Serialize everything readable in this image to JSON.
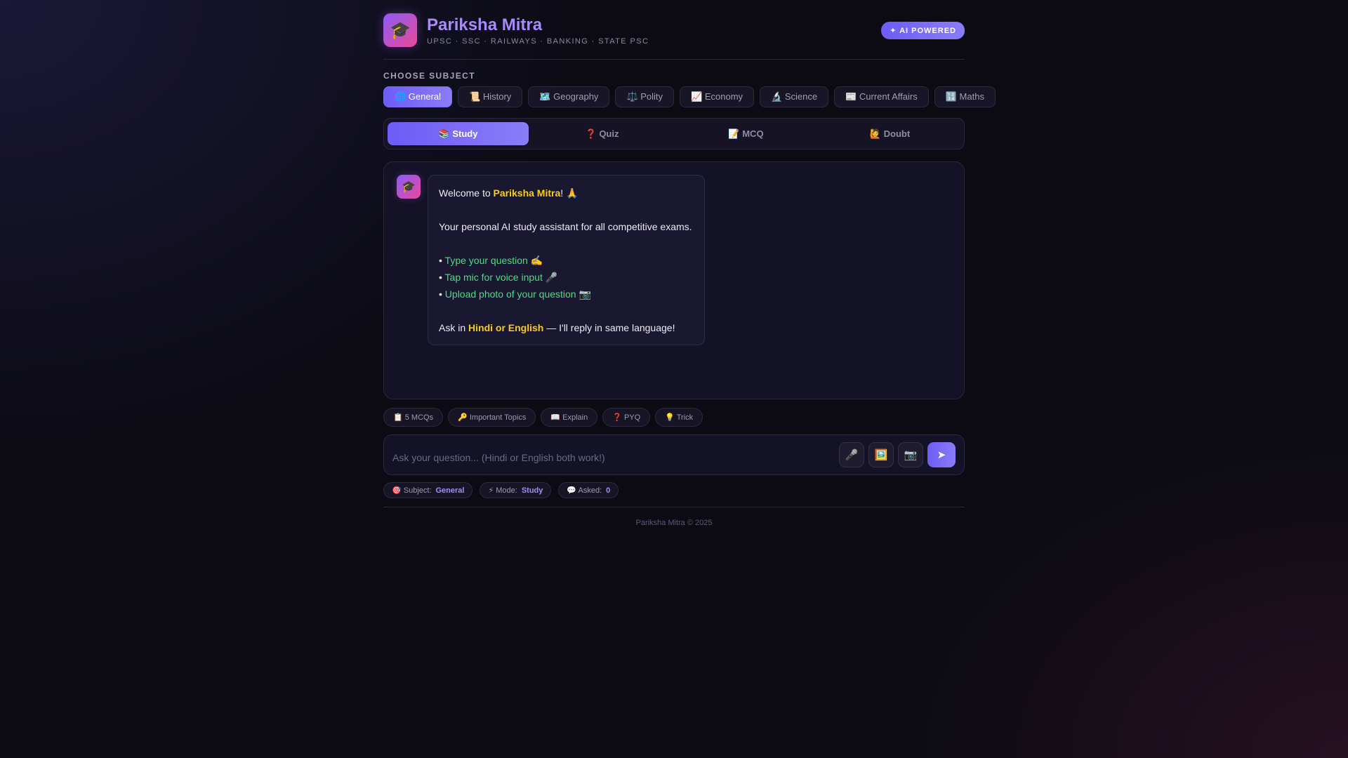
{
  "header": {
    "logo_icon": "graduation-cap-icon",
    "logo_glyph": "🎓",
    "title": "Pariksha Mitra",
    "subtitle": "UPSC · SSC · RAILWAYS · BANKING · STATE PSC",
    "badge": "✦ AI POWERED"
  },
  "subjects": {
    "label": "CHOOSE SUBJECT",
    "items": [
      {
        "label": "🌐 General",
        "active": true
      },
      {
        "label": "📜 History"
      },
      {
        "label": "🗺️ Geography"
      },
      {
        "label": "⚖️ Polity"
      },
      {
        "label": "📈 Economy"
      },
      {
        "label": "🔬 Science"
      },
      {
        "label": "📰 Current Affairs"
      },
      {
        "label": "🔢 Maths"
      }
    ]
  },
  "modes": {
    "items": [
      {
        "label": "📚 Study",
        "active": true
      },
      {
        "label": "❓ Quiz"
      },
      {
        "label": "📝 MCQ"
      },
      {
        "label": "🙋 Doubt"
      }
    ]
  },
  "chat": {
    "bot_avatar": "🎓",
    "welcome_prefix": "Welcome to ",
    "welcome_name": "Pariksha Mitra",
    "welcome_suffix": "! 🙏",
    "intro": "Your personal AI study assistant for all competitive exams.",
    "bullets": [
      {
        "text": "Type your question",
        "emoji": " ✍️"
      },
      {
        "text": "Tap mic for voice input",
        "emoji": " 🎤"
      },
      {
        "text": "Upload photo of your question",
        "emoji": " 📷"
      }
    ],
    "lang_prefix": "Ask in ",
    "lang_hl": "Hindi or English",
    "lang_suffix": " — I'll reply in same language!"
  },
  "quick_actions": [
    "📋 5 MCQs",
    "🔑 Important Topics",
    "📖 Explain",
    "❓ PYQ",
    "💡 Trick"
  ],
  "input": {
    "placeholder": "Ask your question... (Hindi or English both work!)",
    "value": "",
    "mic": "🎤",
    "image": "🖼️",
    "camera": "📷",
    "send": "➤"
  },
  "status": {
    "subject_label": "🎯 Subject:",
    "subject_value": "General",
    "mode_label": "⚡ Mode:",
    "mode_value": "Study",
    "asked_label": "💬 Asked:",
    "asked_value": "0"
  },
  "footer": "Pariksha Mitra © 2025"
}
